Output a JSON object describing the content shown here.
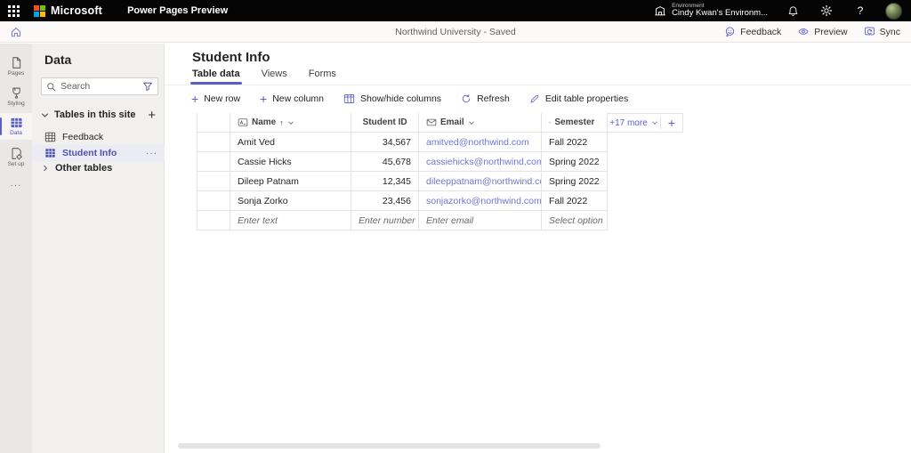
{
  "topbar": {
    "brand": "Microsoft",
    "app": "Power Pages Preview",
    "environment_label": "Environment",
    "environment_name": "Cindy Kwan's Environm...",
    "help": "?"
  },
  "subheader": {
    "title": "Northwind University - Saved",
    "feedback": "Feedback",
    "preview": "Preview",
    "sync": "Sync"
  },
  "rail": {
    "items": [
      {
        "label": "Pages"
      },
      {
        "label": "Styling"
      },
      {
        "label": "Data"
      },
      {
        "label": "Set up"
      }
    ],
    "more": "···"
  },
  "panel": {
    "title": "Data",
    "search_placeholder": "Search",
    "section_title": "Tables in this site",
    "tables": [
      {
        "label": "Feedback"
      },
      {
        "label": "Student Info",
        "more": "···"
      }
    ],
    "other_tables": "Other tables"
  },
  "main": {
    "title": "Student Info",
    "tabs": [
      {
        "label": "Table data"
      },
      {
        "label": "Views"
      },
      {
        "label": "Forms"
      }
    ],
    "toolbar": {
      "new_row": "New row",
      "new_column": "New column",
      "show_hide": "Show/hide columns",
      "refresh": "Refresh",
      "edit_props": "Edit table properties"
    },
    "table": {
      "columns": [
        {
          "label": "Name",
          "sort": "↑"
        },
        {
          "label": "Student ID"
        },
        {
          "label": "Email"
        },
        {
          "label": "Semester"
        }
      ],
      "more_columns": "+17 more",
      "rows": [
        {
          "name": "Amit Ved",
          "student_id": "34,567",
          "email": "amitved@northwind.com",
          "semester": "Fall 2022"
        },
        {
          "name": "Cassie Hicks",
          "student_id": "45,678",
          "email": "cassiehicks@northwind.com",
          "semester": "Spring 2022"
        },
        {
          "name": "Dileep Patnam",
          "student_id": "12,345",
          "email": "dileeppatnam@northwind.com",
          "semester": "Spring 2022"
        },
        {
          "name": "Sonja Zorko",
          "student_id": "23,456",
          "email": "sonjazorko@northwind.com",
          "semester": "Fall 2022"
        }
      ],
      "new_row_placeholders": {
        "name": "Enter text",
        "student_id": "Enter number",
        "email": "Enter email",
        "semester": "Select option"
      }
    }
  },
  "colors": {
    "accent": "#5B5FC7",
    "selected_text": "#4F52B2",
    "link": "#6F74D9",
    "topbar_bg": "#050505",
    "ms_red": "#F25022",
    "ms_green": "#7FBA00",
    "ms_blue": "#00A4EF",
    "ms_yellow": "#FFB900"
  }
}
